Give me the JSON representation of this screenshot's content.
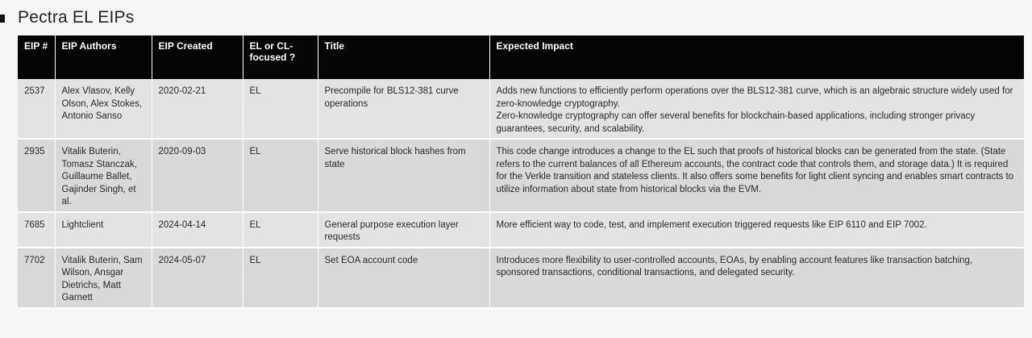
{
  "slide": {
    "title": "Pectra EL EIPs"
  },
  "table": {
    "headers": {
      "eip_num": "EIP #",
      "authors": "EIP Authors",
      "created": "EIP Created",
      "focus": "EL or CL-focused ?",
      "title": "Title",
      "impact": "Expected Impact"
    },
    "rows": [
      {
        "eip_num": "2537",
        "authors": "Alex Vlasov, Kelly Olson, Alex Stokes, Antonio Sanso",
        "created": "2020-02-21",
        "focus": "EL",
        "title": "Precompile for BLS12-381 curve operations",
        "impact_1": "Adds new functions to efficiently perform operations over the BLS12-381 curve, which is an algebraic structure widely used for zero-knowledge cryptography.",
        "impact_2": "Zero-knowledge cryptography can offer several benefits for blockchain-based applications, including stronger privacy guarantees, security, and scalability."
      },
      {
        "eip_num": "2935",
        "authors": "Vitalik Buterin, Tomasz Stanczak, Guillaume Ballet, Gajinder Singh, et al.",
        "created": "2020-09-03",
        "focus": "EL",
        "title": "Serve historical block hashes from state",
        "impact_1": "This code change introduces a change to the EL such that proofs of historical blocks can be generated from the state. (State refers to the current balances of all Ethereum accounts, the contract code that controls them, and storage data.) It is required for the Verkle transition and stateless clients. It also offers some benefits for light client syncing and enables smart contracts to utilize information about state from historical blocks via the EVM.",
        "impact_2": ""
      },
      {
        "eip_num": "7685",
        "authors": "Lightclient",
        "created": "2024-04-14",
        "focus": "EL",
        "title": "General purpose execution layer requests",
        "impact_1": "More efficient way to code, test, and implement execution triggered requests like EIP 6110 and EIP 7002.",
        "impact_2": ""
      },
      {
        "eip_num": "7702",
        "authors": "Vitalik Buterin, Sam Wilson, Ansgar Dietrichs, Matt Garnett",
        "created": "2024-05-07",
        "focus": "EL",
        "title": "Set EOA account code",
        "impact_1": "Introduces more flexibility to user-controlled accounts, EOAs, by enabling account features like transaction batching, sponsored transactions, conditional transactions, and delegated security.",
        "impact_2": ""
      }
    ]
  }
}
